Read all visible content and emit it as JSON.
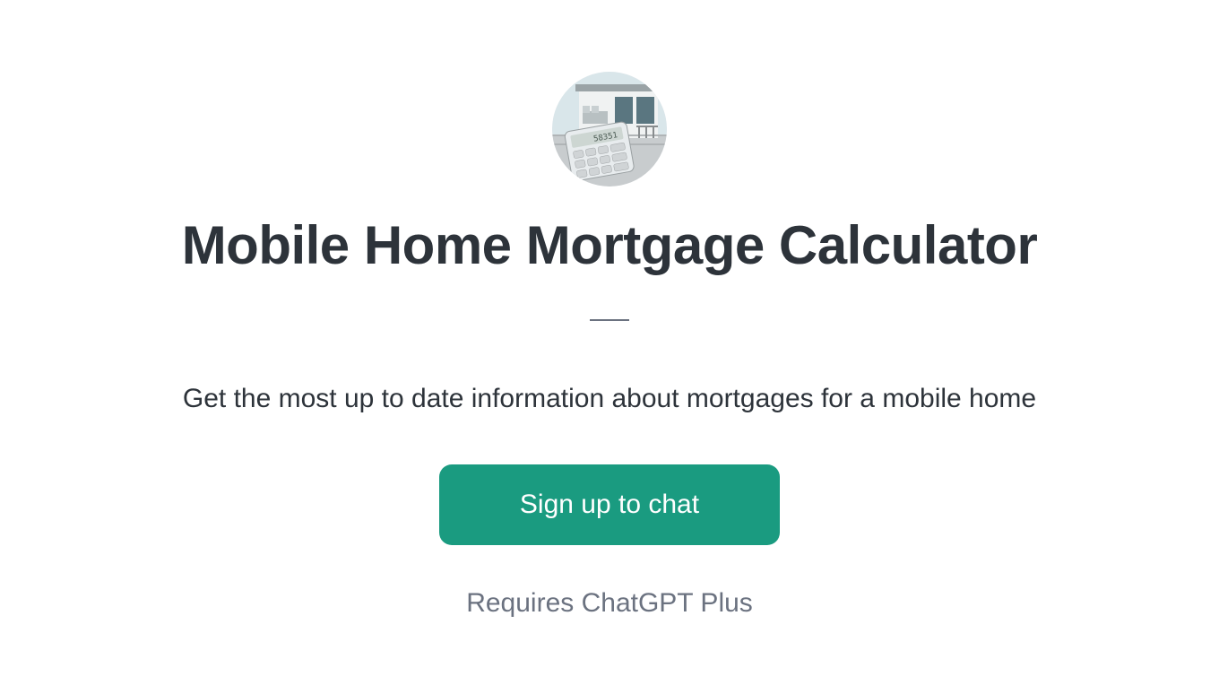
{
  "avatar": {
    "name": "calculator-house-icon"
  },
  "title": "Mobile Home Mortgage Calculator",
  "subtitle": "Get the most up to date information about mortgages for a mobile home",
  "cta": {
    "label": "Sign up to chat"
  },
  "requirement": "Requires ChatGPT Plus"
}
